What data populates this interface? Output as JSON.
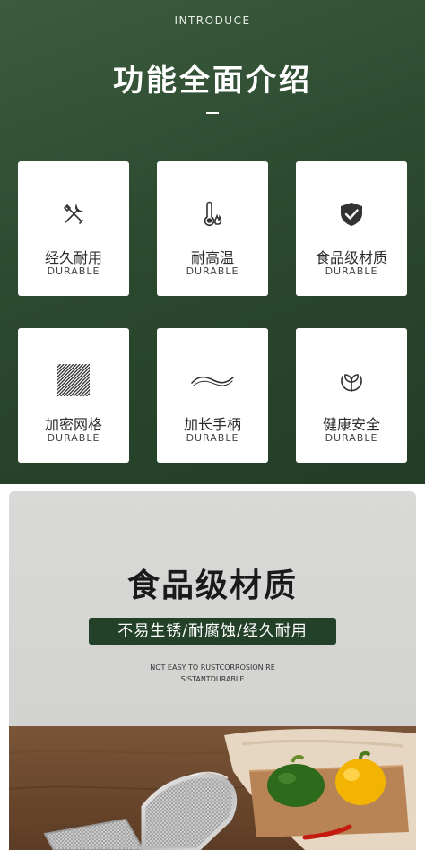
{
  "header": {
    "kicker": "INTRODUCE",
    "title": "功能全面介绍"
  },
  "features": [
    {
      "title": "经久耐用",
      "subtitle": "DURABLE",
      "icon": "tools-icon"
    },
    {
      "title": "耐高温",
      "subtitle": "DURABLE",
      "icon": "thermometer-flame-icon"
    },
    {
      "title": "食品级材质",
      "subtitle": "DURABLE",
      "icon": "shield-check-icon"
    },
    {
      "title": "加密网格",
      "subtitle": "DURABLE",
      "icon": "mesh-icon"
    },
    {
      "title": "加长手柄",
      "subtitle": "DURABLE",
      "icon": "wavy-handle-icon"
    },
    {
      "title": "健康安全",
      "subtitle": "DURABLE",
      "icon": "leaf-circle-icon"
    }
  ],
  "section2": {
    "title": "食品级材质",
    "tagline": "不易生锈/耐腐蚀/经久耐用",
    "english_line1": "NOT EASY TO RUSTCORROSION RE",
    "english_line2": "SISTANTDURABLE"
  },
  "colors": {
    "dark_green": "#2c4a2f",
    "pill_green": "#234028",
    "card_bg": "#ffffff",
    "panel_gray": "#d7d7d5"
  }
}
